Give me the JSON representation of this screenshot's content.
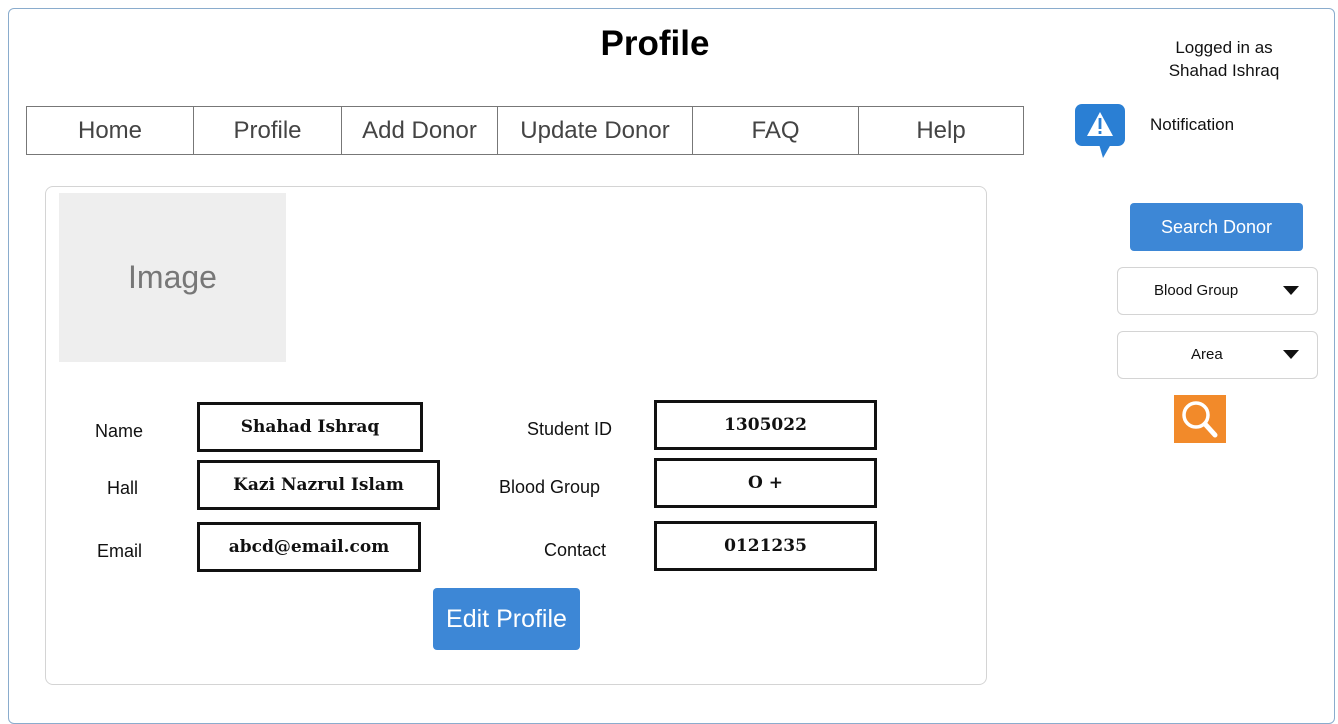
{
  "header": {
    "title": "Profile",
    "login_line1": "Logged in as",
    "login_line2": "Shahad Ishraq",
    "notification_label": "Notification"
  },
  "nav": {
    "items": [
      {
        "label": "Home"
      },
      {
        "label": "Profile"
      },
      {
        "label": "Add Donor"
      },
      {
        "label": "Update Donor"
      },
      {
        "label": "FAQ"
      },
      {
        "label": "Help"
      }
    ]
  },
  "profile": {
    "image_placeholder": "Image",
    "fields": {
      "name": {
        "label": "Name",
        "value": "Shahad Ishraq"
      },
      "hall": {
        "label": "Hall",
        "value": "Kazi Nazrul Islam"
      },
      "email": {
        "label": "Email",
        "value": "abcd@email.com"
      },
      "student_id": {
        "label": "Student ID",
        "value": "1305022"
      },
      "blood_group": {
        "label": "Blood Group",
        "value": "O +"
      },
      "contact": {
        "label": "Contact",
        "value": "0121235"
      }
    },
    "edit_button": "Edit Profile"
  },
  "search": {
    "button_label": "Search Donor",
    "blood_group_select": "Blood Group",
    "area_select": "Area"
  },
  "colors": {
    "accent_blue": "#3d87d6",
    "search_orange": "#f28a2a",
    "notification_blue": "#2a7fd4"
  },
  "icons": {
    "notification": "notification-warning-icon",
    "search": "magnifier-icon",
    "dropdown": "caret-down-icon"
  }
}
